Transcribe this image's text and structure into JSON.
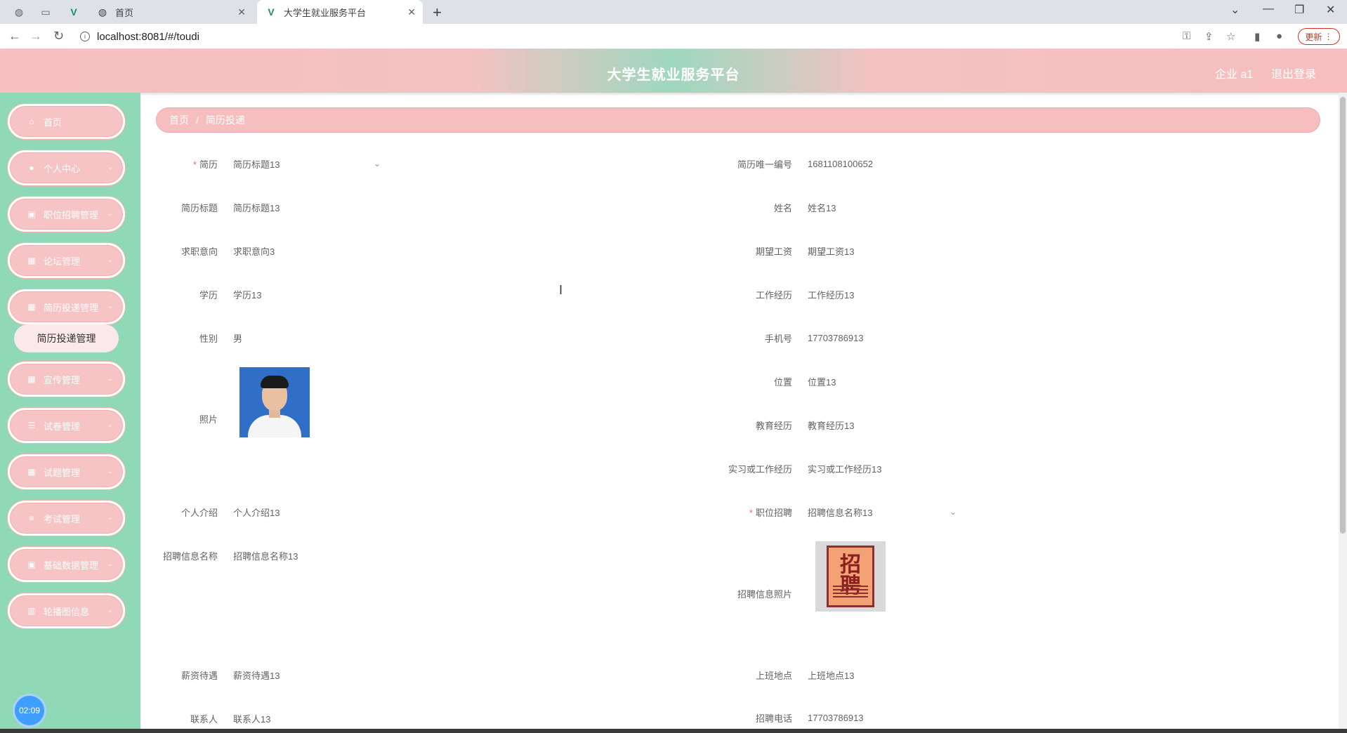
{
  "browser": {
    "tabs": [
      {
        "title": "首页"
      },
      {
        "title": "大学生就业服务平台"
      }
    ],
    "url": "localhost:8081/#/toudi",
    "update_label": "更新"
  },
  "header": {
    "title": "大学生就业服务平台",
    "user": "企业 a1",
    "logout": "退出登录"
  },
  "sidebar": {
    "items": [
      {
        "label": "首页",
        "icon": "home-icon"
      },
      {
        "label": "个人中心",
        "icon": "user-icon"
      },
      {
        "label": "职位招聘管理",
        "icon": "clipboard-icon"
      },
      {
        "label": "论坛管理",
        "icon": "grid-icon"
      },
      {
        "label": "简历投递管理",
        "icon": "grid-icon"
      },
      {
        "label": "宣传管理",
        "icon": "grid-icon"
      },
      {
        "label": "试卷管理",
        "icon": "sliders-icon"
      },
      {
        "label": "试题管理",
        "icon": "grid-icon"
      },
      {
        "label": "考试管理",
        "icon": "list-icon"
      },
      {
        "label": "基础数据管理",
        "icon": "clipboard-icon"
      },
      {
        "label": "轮播图信息",
        "icon": "chart-icon"
      }
    ],
    "submenu_active": "简历投递管理",
    "clock": "02:09"
  },
  "breadcrumb": {
    "home": "首页",
    "separator": "/",
    "current": "简历投递"
  },
  "form": {
    "left": [
      {
        "label": "简历",
        "value": "简历标题13",
        "required": "*"
      },
      {
        "label": "简历标题",
        "value": "简历标题13"
      },
      {
        "label": "求职意向",
        "value": "求职意向3"
      },
      {
        "label": "学历",
        "value": "学历13"
      },
      {
        "label": "性别",
        "value": "男"
      },
      {
        "label": "照片"
      },
      {
        "label": "个人介绍",
        "value": "个人介绍13"
      },
      {
        "label": "招聘信息名称",
        "value": "招聘信息名称13"
      },
      {
        "label": "薪资待遇",
        "value": "薪资待遇13"
      },
      {
        "label": "联系人",
        "value": "联系人13"
      }
    ],
    "right": [
      {
        "label": "简历唯一编号",
        "value": "1681108100652"
      },
      {
        "label": "姓名",
        "value": "姓名13"
      },
      {
        "label": "期望工资",
        "value": "期望工资13"
      },
      {
        "label": "工作经历",
        "value": "工作经历13"
      },
      {
        "label": "手机号",
        "value": "17703786913"
      },
      {
        "label": "位置",
        "value": "位置13"
      },
      {
        "label": "教育经历",
        "value": "教育经历13"
      },
      {
        "label": "实习或工作经历",
        "value": "实习或工作经历13"
      },
      {
        "label": "职位招聘",
        "value": "招聘信息名称13",
        "required": "*"
      },
      {
        "label": "招聘信息照片"
      },
      {
        "label": "上班地点",
        "value": "上班地点13"
      },
      {
        "label": "招聘电话",
        "value": "17703786913"
      }
    ]
  }
}
